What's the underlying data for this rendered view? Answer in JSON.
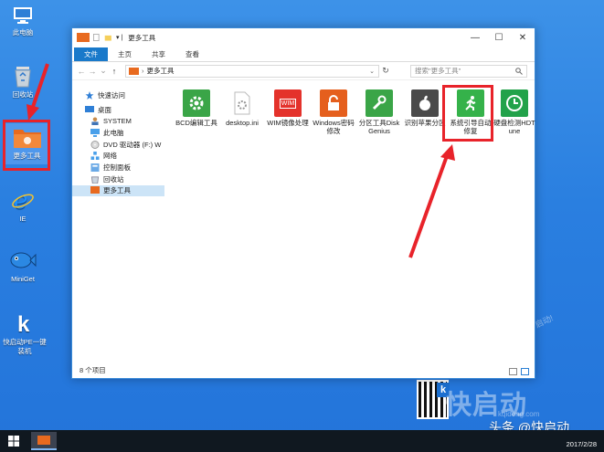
{
  "desktop": {
    "icons": [
      {
        "label": "此电脑",
        "icon": "computer-icon"
      },
      {
        "label": "回收站",
        "icon": "recycle-bin-icon"
      },
      {
        "label": "更多工具",
        "icon": "toolbox-folder-icon"
      },
      {
        "label": "IE",
        "icon": "ie-icon"
      },
      {
        "label": "MiniGet",
        "icon": "fish-icon"
      },
      {
        "label": "快启动PE一键装机",
        "icon": "k-icon"
      }
    ],
    "brand": "快启动",
    "brand_sub": "kqidong.com",
    "slogan": "启动!",
    "watermark": "头条 @快启动",
    "date": "2017/2/28",
    "qr_badge": "k"
  },
  "window": {
    "title": "更多工具",
    "tabs": [
      "文件",
      "主页",
      "共享",
      "查看"
    ],
    "controls": {
      "minimize": "—",
      "maximize": "☐",
      "close": "✕"
    },
    "nav": {
      "back": "←",
      "forward": "→",
      "up": "↑",
      "history": "⌄"
    },
    "address": {
      "path": "更多工具",
      "chevron": "›",
      "refresh": "↻"
    },
    "search_placeholder": "搜索\"更多工具\"",
    "sidebar": [
      {
        "label": "快速访问",
        "icon": "star-icon"
      },
      {
        "label": "桌面",
        "icon": "desktop-icon"
      },
      {
        "label": "SYSTEM",
        "icon": "user-icon"
      },
      {
        "label": "此电脑",
        "icon": "computer-icon"
      },
      {
        "label": "DVD 驱动器 (F:) W",
        "icon": "dvd-icon"
      },
      {
        "label": "网络",
        "icon": "network-icon"
      },
      {
        "label": "控制面板",
        "icon": "control-panel-icon"
      },
      {
        "label": "回收站",
        "icon": "recycle-bin-icon"
      },
      {
        "label": "更多工具",
        "icon": "folder-icon"
      }
    ],
    "files": [
      {
        "name": "BCD编辑工具",
        "color": "#3aa547",
        "icon": "gear-icon"
      },
      {
        "name": "desktop.ini",
        "color": "#ffffff",
        "icon": "ini-file-icon"
      },
      {
        "name": "WIM镜像处理",
        "color": "#e4322b",
        "icon": "wim-icon",
        "badge": "WIM"
      },
      {
        "name": "Windows密码修改",
        "color": "#e55f1d",
        "icon": "lock-icon"
      },
      {
        "name": "分区工具DiskGenius",
        "color": "#3aa547",
        "icon": "wrench-icon"
      },
      {
        "name": "识别苹果分区",
        "color": "#4a4a4a",
        "icon": "apple-icon"
      },
      {
        "name": "系统引导自动修复",
        "color": "#35b24a",
        "icon": "running-man-icon"
      },
      {
        "name": "硬盘检测HDTune",
        "color": "#22a24a",
        "icon": "clock-icon"
      }
    ],
    "status": "8 个项目"
  }
}
